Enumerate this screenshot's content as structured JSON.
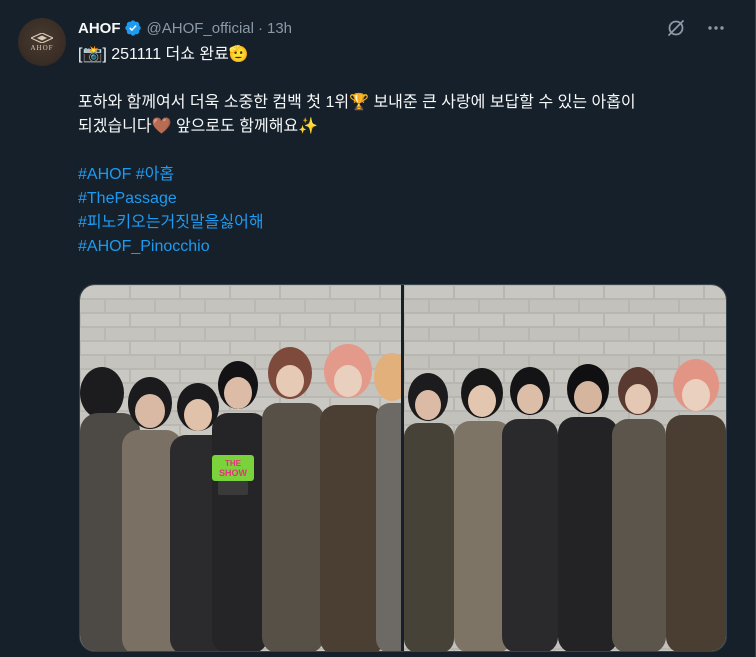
{
  "author": {
    "display_name": "AHOF",
    "handle": "@AHOF_official",
    "separator": "·",
    "time": "13h",
    "avatar_text": "AHOF"
  },
  "tweet": {
    "line1": "[📸] 251111 더쇼 완료🫡",
    "line2": "포하와 함께여서 더욱 소중한 컴백 첫 1위🏆 보내준 큰 사랑에 보답할 수 있는 아홉이",
    "line3": "되겠습니다🤎 앞으로도 함께해요✨",
    "hashtags": {
      "h1": "#AHOF",
      "h2": "#아홉",
      "h3": "#ThePassage",
      "h4": "#피노키오는거짓말을싫어해",
      "h5": "#AHOF_Pinocchio"
    }
  },
  "media": {
    "trophy_text_top": "THE",
    "trophy_text_bottom": "SHOW"
  },
  "colors": {
    "background": "#15202b",
    "text": "#f7f9f9",
    "secondary": "#8b98a5",
    "link": "#1d9bf0",
    "verified": "#1d9bf0"
  }
}
